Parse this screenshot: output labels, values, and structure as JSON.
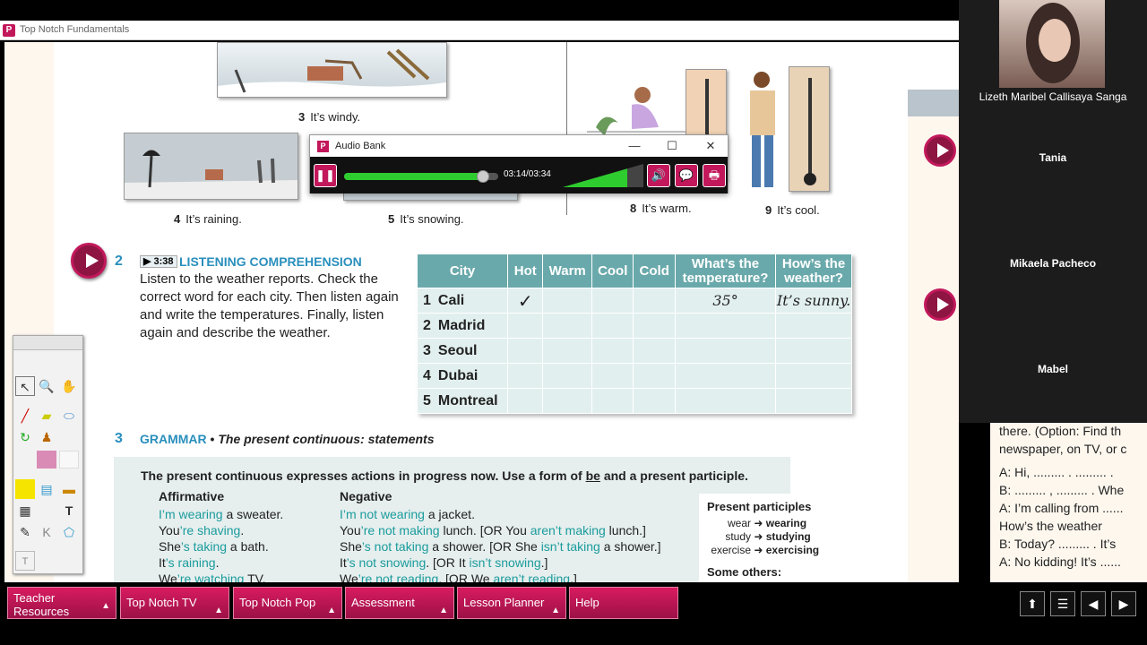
{
  "app": {
    "title": "Top Notch Fundamentals"
  },
  "captions": [
    {
      "num": "3",
      "text": "It’s windy."
    },
    {
      "num": "4",
      "text": "It’s raining."
    },
    {
      "num": "5",
      "text": "It’s snowing."
    },
    {
      "num": "8",
      "text": "It’s warm."
    },
    {
      "num": "9",
      "text": "It’s cool."
    }
  ],
  "audio": {
    "title": "Audio Bank",
    "time": "03:14/03:34",
    "progress": 0.93,
    "volume": 0.8
  },
  "section2": {
    "num": "2",
    "track": "3:38",
    "heading": "LISTENING COMPREHENSION",
    "instructions": "Listen to the weather reports. Check the correct word for each city. Then listen again and write the temperatures. Finally, listen again and describe the weather."
  },
  "table": {
    "headers": [
      "City",
      "Hot",
      "Warm",
      "Cool",
      "Cold",
      "What’s the temperature?",
      "How’s the weather?"
    ],
    "rows": [
      {
        "num": "1",
        "city": "Cali",
        "hot": "✓",
        "temp": "35°",
        "weather": "It’s sunny."
      },
      {
        "num": "2",
        "city": "Madrid",
        "hot": "",
        "temp": "",
        "weather": ""
      },
      {
        "num": "3",
        "city": "Seoul",
        "hot": "",
        "temp": "",
        "weather": ""
      },
      {
        "num": "4",
        "city": "Dubai",
        "hot": "",
        "temp": "",
        "weather": ""
      },
      {
        "num": "5",
        "city": "Montreal",
        "hot": "",
        "temp": "",
        "weather": ""
      }
    ]
  },
  "section3": {
    "num": "3",
    "heading": "GRAMMAR",
    "subheading": "The present continuous: statements",
    "rule_prefix": "The present continuous expresses actions in progress now. Use a form of ",
    "rule_be": "be",
    "rule_suffix": " and a present participle.",
    "affirmative_label": "Affirmative",
    "negative_label": "Negative",
    "affirmative": [
      {
        "pre": "I",
        "hl": "’m wearing",
        "post": " a sweater."
      },
      {
        "pre": "You",
        "hl": "’re shaving",
        "post": "."
      },
      {
        "pre": "She",
        "hl": "’s taking",
        "post": " a bath."
      },
      {
        "pre": "It",
        "hl": "’s raining",
        "post": "."
      },
      {
        "pre": "We",
        "hl": "’re watching",
        "post": " TV."
      }
    ],
    "negative": [
      {
        "pre": "I",
        "hl": "’m not wearing",
        "post": " a jacket.",
        "alt_pre": "",
        "alt_hl": "",
        "alt_post": ""
      },
      {
        "pre": "You",
        "hl": "’re not making",
        "post": " lunch. [OR You ",
        "alt_hl": "aren’t making",
        "alt_post": " lunch.]"
      },
      {
        "pre": "She",
        "hl": "’s not taking",
        "post": " a shower. [OR She ",
        "alt_hl": "isn’t taking",
        "alt_post": " a shower.]"
      },
      {
        "pre": "It",
        "hl": "’s not snowing",
        "post": ". [OR It ",
        "alt_hl": "isn’t snowing",
        "alt_post": ".]"
      },
      {
        "pre": "We",
        "hl": "’re not reading",
        "post": ". [OR We ",
        "alt_hl": "aren’t reading",
        "alt_post": ".]"
      }
    ],
    "participles_title": "Present participles",
    "participles": [
      {
        "base": "wear",
        "ing": "wearing"
      },
      {
        "base": "study",
        "ing": "studying"
      },
      {
        "base": "exercise",
        "ing": "exercising"
      }
    ],
    "others_label": "Some others:"
  },
  "participants": [
    {
      "name": "Lizeth Maribel Callisaya Sanga"
    },
    {
      "name": "Tania"
    },
    {
      "name": "Mikaela Pacheco"
    },
    {
      "name": "Mabel"
    }
  ],
  "right_text": [
    "there. (Option: Find th",
    "newspaper, on TV, or c",
    "A:  Hi, ......... . ......... .",
    "B:  ......... , ......... . Whe",
    "A:  I’m calling from ......",
    "      How’s the weather",
    "B:  Today? ......... . It’s",
    "A:  No kidding! It’s ......"
  ],
  "nav": [
    {
      "label": "Teacher Resources"
    },
    {
      "label": "Top Notch TV"
    },
    {
      "label": "Top Notch Pop"
    },
    {
      "label": "Assessment"
    },
    {
      "label": "Lesson Planner"
    },
    {
      "label": "Help"
    }
  ],
  "colors": {
    "brand": "#c2185b",
    "teal": "#1b9c9c",
    "blue": "#2a8fbd"
  }
}
